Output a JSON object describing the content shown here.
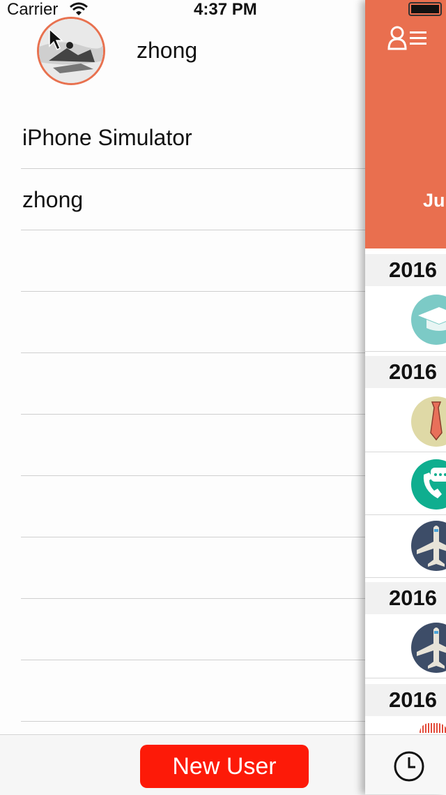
{
  "status_bar": {
    "carrier": "Carrier",
    "time": "4:37 PM"
  },
  "menu": {
    "username": "zhong",
    "items": [
      "iPhone Simulator",
      "zhong",
      "",
      "",
      "",
      "",
      "",
      "",
      "",
      "",
      ""
    ],
    "new_user_label": "New User"
  },
  "panel": {
    "header_text": "Ju",
    "sections": [
      "2016",
      "2016",
      "2016",
      "2016"
    ],
    "icons": [
      "graduation-cap-icon",
      "necktie-icon",
      "phone-chat-icon",
      "airplane-icon",
      "airplane-icon"
    ]
  },
  "colors": {
    "accent": "#e96f4f",
    "button": "#fd1a08"
  }
}
